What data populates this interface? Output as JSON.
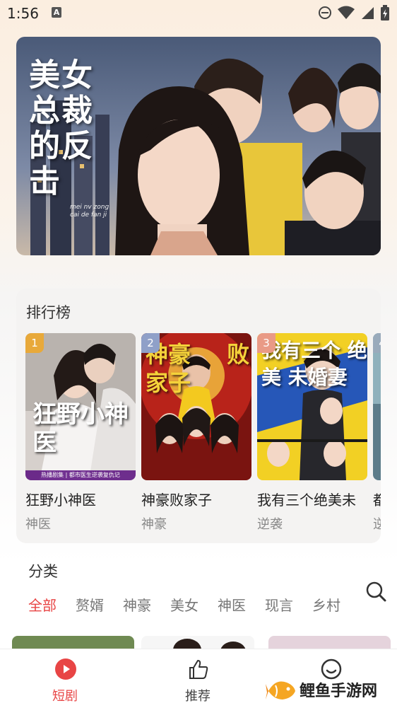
{
  "status_bar": {
    "time": "1:56",
    "notification_icon": "A"
  },
  "banner": {
    "title": "美女总裁的反击",
    "pinyin": "mei nv zong cai de fan ji",
    "title_lines": [
      "美女",
      "总裁",
      "的",
      "反击"
    ]
  },
  "ranking": {
    "title": "排行榜",
    "items": [
      {
        "rank": "1",
        "name": "狂野小神医",
        "tag": "神医",
        "poster_text": "狂野小神医",
        "poster_strip": "热播剧集 | 都市医生逆袭复仇记",
        "badge_color": "#e8a93a"
      },
      {
        "rank": "2",
        "name": "神豪败家子",
        "tag": "神豪",
        "poster_text": "神豪 败家子",
        "badge_color": "#8fa0c8"
      },
      {
        "rank": "3",
        "name": "我有三个绝美未",
        "tag": "逆袭",
        "poster_text": "我有三个 绝美 未婚妻",
        "badge_color": "#e99a86"
      },
      {
        "rank": "4",
        "name": "都",
        "tag": "逆",
        "badge_color": "#9ab"
      }
    ]
  },
  "category": {
    "title": "分类",
    "tabs": [
      "全部",
      "赘婿",
      "神豪",
      "美女",
      "神医",
      "现言",
      "乡村"
    ],
    "active_index": 0,
    "search_icon": "search-icon"
  },
  "bottom_nav": {
    "items": [
      {
        "label": "短剧",
        "icon": "play-circle-icon",
        "active": true
      },
      {
        "label": "推荐",
        "icon": "thumbs-up-icon",
        "active": false
      },
      {
        "label": "",
        "icon": "smile-face-icon",
        "active": false
      }
    ]
  },
  "watermark": {
    "text": "鲤鱼手游网",
    "icon": "fish-logo-icon"
  },
  "colors": {
    "accent": "#e84545",
    "background": "#fbeee0"
  }
}
